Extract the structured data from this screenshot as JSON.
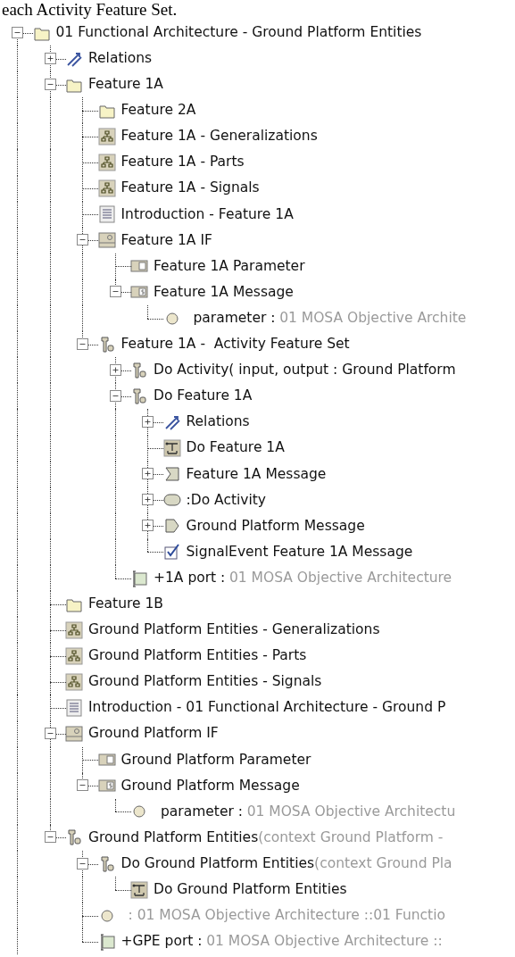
{
  "caption": "each Activity Feature Set.",
  "tree": [
    {
      "label": "01 Functional Architecture - Ground Platform Entities",
      "kind": "folder",
      "expanded": true,
      "children": [
        {
          "label": "Relations",
          "kind": "relations",
          "expanded": false
        },
        {
          "label": "Feature 1A",
          "kind": "folder",
          "expanded": true,
          "children": [
            {
              "label": "Feature 2A",
              "kind": "folder"
            },
            {
              "label": "Feature 1A - Generalizations",
              "kind": "diagram"
            },
            {
              "label": "Feature 1A - Parts",
              "kind": "diagram"
            },
            {
              "label": "Feature 1A - Signals",
              "kind": "diagram"
            },
            {
              "label": "Introduction - Feature 1A",
              "kind": "document"
            },
            {
              "label": "Feature 1A IF",
              "kind": "interface",
              "expanded": true,
              "children": [
                {
                  "label": "Feature 1A Parameter",
                  "kind": "datatype"
                },
                {
                  "label": "Feature 1A Message",
                  "kind": "signal",
                  "expanded": true,
                  "children": [
                    {
                      "label": "parameter :",
                      "detail": "01 MOSA Objective Archite",
                      "kind": "property"
                    }
                  ]
                }
              ]
            },
            {
              "label": "Feature 1A -  Activity Feature Set",
              "kind": "activity",
              "expanded": true,
              "children": [
                {
                  "label": "Do Activity( input, output : Ground Platform",
                  "kind": "activity",
                  "expanded": false
                },
                {
                  "label": "Do Feature 1A",
                  "kind": "activity",
                  "expanded": true,
                  "children": [
                    {
                      "label": "Relations",
                      "kind": "relations",
                      "expanded": false
                    },
                    {
                      "label": "Do Feature 1A",
                      "kind": "activity-diagram"
                    },
                    {
                      "label": "Feature 1A Message",
                      "kind": "accept-event",
                      "expanded": false
                    },
                    {
                      "label": ":Do Activity",
                      "kind": "call-action",
                      "expanded": false
                    },
                    {
                      "label": "Ground Platform Message",
                      "kind": "send-signal",
                      "expanded": false
                    },
                    {
                      "label": "SignalEvent Feature 1A Message",
                      "kind": "signal-event"
                    }
                  ]
                },
                {
                  "label": "+1A port :",
                  "detail": "01 MOSA Objective Architecture",
                  "kind": "port"
                }
              ]
            }
          ]
        },
        {
          "label": "Feature 1B",
          "kind": "folder"
        },
        {
          "label": "Ground Platform Entities - Generalizations",
          "kind": "diagram"
        },
        {
          "label": "Ground Platform Entities - Parts",
          "kind": "diagram"
        },
        {
          "label": "Ground Platform Entities - Signals",
          "kind": "diagram"
        },
        {
          "label": "Introduction - 01 Functional Architecture - Ground P",
          "kind": "document"
        },
        {
          "label": "Ground Platform IF",
          "kind": "interface",
          "expanded": true,
          "children": [
            {
              "label": "Ground Platform Parameter",
              "kind": "datatype"
            },
            {
              "label": "Ground Platform Message",
              "kind": "signal",
              "expanded": true,
              "children": [
                {
                  "label": "parameter :",
                  "detail": "01 MOSA Objective Architectu",
                  "kind": "property"
                }
              ]
            }
          ]
        },
        {
          "label": "Ground Platform Entities",
          "detail": "(context Ground Platform -",
          "kind": "activity",
          "expanded": true,
          "children": [
            {
              "label": "Do Ground Platform Entities",
              "detail": "(context Ground Pla",
              "kind": "activity",
              "expanded": true,
              "children": [
                {
                  "label": "Do Ground Platform Entities",
                  "kind": "activity-diagram"
                }
              ]
            },
            {
              "detail": ": 01 MOSA Objective Architecture ::01 Functio",
              "kind": "property"
            },
            {
              "label": "+GPE port :",
              "detail": "01 MOSA Objective Architecture ::",
              "kind": "port"
            }
          ]
        }
      ]
    }
  ]
}
